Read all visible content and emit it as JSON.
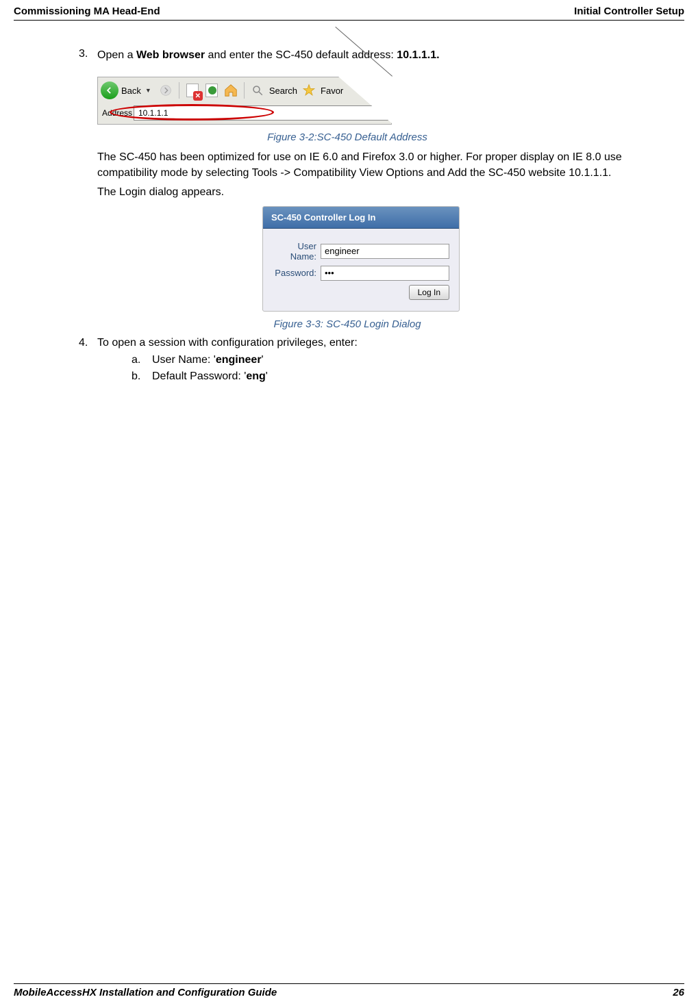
{
  "header": {
    "left": "Commissioning MA Head-End",
    "right": "Initial Controller Setup"
  },
  "step3": {
    "num": "3.",
    "pre": "Open a ",
    "bold1": "Web browser",
    "mid": " and enter the SC-450 default address: ",
    "bold2": "10.1.1.1."
  },
  "toolbar": {
    "back": "Back",
    "search": "Search",
    "favorites": "Favor",
    "addressLabel": "Address",
    "addressValue": "10.1.1.1"
  },
  "caption1": "Figure 3-2:SC-450 Default Address",
  "para1": "The SC-450 has been optimized for use on IE 6.0 and Firefox 3.0 or higher. For proper display on IE 8.0 use compatibility mode by selecting Tools -> Compatibility View Options and Add the SC-450 website 10.1.1.1.",
  "para2": "The Login dialog appears.",
  "login": {
    "title": "SC-450 Controller Log In",
    "userLabel": "User Name:",
    "userValue": "engineer",
    "passLabel": "Password:",
    "passValue": "•••",
    "button": "Log In"
  },
  "caption2": "Figure 3-3: SC-450 Login Dialog",
  "step4": {
    "num": "4.",
    "text": "To open a session with configuration privileges, enter:"
  },
  "subA": {
    "letter": "a.",
    "pre": "User Name: '",
    "bold": "engineer",
    "post": "'"
  },
  "subB": {
    "letter": "b.",
    "pre": "Default Password: '",
    "bold": "eng",
    "post": "'"
  },
  "footer": {
    "left": "MobileAccessHX Installation and Configuration Guide",
    "right": "26"
  }
}
